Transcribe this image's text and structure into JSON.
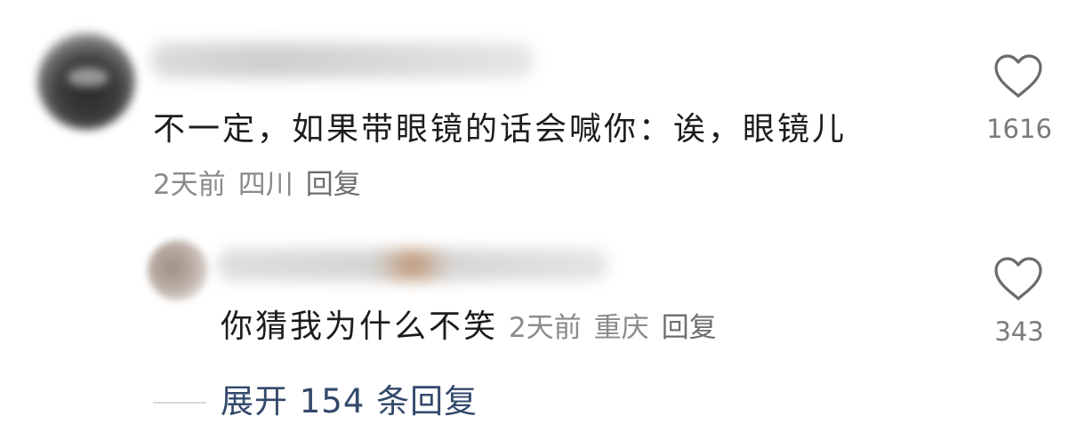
{
  "comment": {
    "text": "不一定，如果带眼镜的话会喊你：诶，眼镜儿",
    "time": "2天前",
    "location": "四川",
    "reply_label": "回复",
    "like_count": "1616"
  },
  "reply": {
    "text": "你猜我为什么不笑",
    "time": "2天前",
    "location": "重庆",
    "reply_label": "回复",
    "like_count": "343"
  },
  "expand": {
    "label": "展开 154 条回复"
  },
  "icons": {
    "like": "heart-outline-icon"
  },
  "colors": {
    "text": "#1c1c1c",
    "meta": "#8a8a8a",
    "link": "#33496b"
  }
}
